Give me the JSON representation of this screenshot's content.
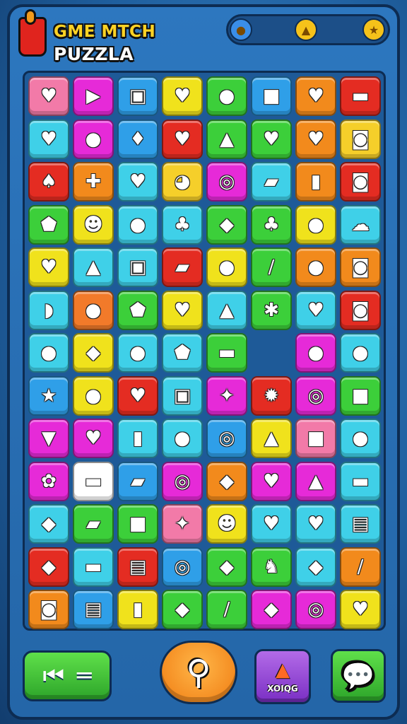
{
  "header": {
    "title_line1": "GME MTCH",
    "title_line2": "PUZZLA",
    "status": [
      {
        "icon": "globe-icon",
        "glyph": "●",
        "color": "#3a8ee8"
      },
      {
        "icon": "bell-icon",
        "glyph": "▲",
        "color": "#f5c21a"
      },
      {
        "icon": "star-icon",
        "glyph": "★",
        "color": "#f5c21a"
      }
    ]
  },
  "board": {
    "rows": 13,
    "cols": 8,
    "tiles": [
      [
        {
          "icon": "heart-icon",
          "glyph": "♥",
          "color": "#f27aa8"
        },
        {
          "icon": "triangle-icon",
          "glyph": "▶",
          "color": "#e62ad8"
        },
        {
          "icon": "scroll-icon",
          "glyph": "▣",
          "color": "#2f9fe8"
        },
        {
          "icon": "heart-icon",
          "glyph": "♥",
          "color": "#f0e21c"
        },
        {
          "icon": "orb-icon",
          "glyph": "●",
          "color": "#3ccf3a"
        },
        {
          "icon": "robot-icon",
          "glyph": "■",
          "color": "#2f9fe8"
        },
        {
          "icon": "heart-icon",
          "glyph": "♥",
          "color": "#f28a1c"
        },
        {
          "icon": "pot-icon",
          "glyph": "▬",
          "color": "#e42c22"
        }
      ],
      [
        {
          "icon": "heart-icon",
          "glyph": "♥",
          "color": "#3fd0e8"
        },
        {
          "icon": "blob-icon",
          "glyph": "●",
          "color": "#e62ad8"
        },
        {
          "icon": "strawberry-icon",
          "glyph": "♦",
          "color": "#2f9fe8"
        },
        {
          "icon": "shield-icon",
          "glyph": "♥",
          "color": "#e42c22"
        },
        {
          "icon": "triangle-icon",
          "glyph": "▲",
          "color": "#3ccf3a"
        },
        {
          "icon": "heart-icon",
          "glyph": "♥",
          "color": "#3ccf3a"
        },
        {
          "icon": "heart-icon",
          "glyph": "♥",
          "color": "#f28a1c"
        },
        {
          "icon": "safe-icon",
          "glyph": "◙",
          "color": "#f5cf2a"
        }
      ],
      [
        {
          "icon": "mushroom-icon",
          "glyph": "♠",
          "color": "#e42c22"
        },
        {
          "icon": "cross-icon",
          "glyph": "✚",
          "color": "#f28a1c"
        },
        {
          "icon": "heart-icon",
          "glyph": "♥",
          "color": "#3fd0e8"
        },
        {
          "icon": "bear-icon",
          "glyph": "◕",
          "color": "#f5cf2a"
        },
        {
          "icon": "spiral-icon",
          "glyph": "◎",
          "color": "#e62ad8"
        },
        {
          "icon": "bandage-icon",
          "glyph": "▰",
          "color": "#3fd0e8"
        },
        {
          "icon": "battery-icon",
          "glyph": "▮",
          "color": "#f28a1c"
        },
        {
          "icon": "safe-icon",
          "glyph": "◙",
          "color": "#e42c22"
        }
      ],
      [
        {
          "icon": "gem-icon",
          "glyph": "⬟",
          "color": "#3ccf3a"
        },
        {
          "icon": "smile-icon",
          "glyph": "☻",
          "color": "#f0e21c"
        },
        {
          "icon": "apple-icon",
          "glyph": "●",
          "color": "#3fd0e8"
        },
        {
          "icon": "leaf-icon",
          "glyph": "♣",
          "color": "#3fd0e8"
        },
        {
          "icon": "diamond-icon",
          "glyph": "◆",
          "color": "#3ccf3a"
        },
        {
          "icon": "bush-icon",
          "glyph": "♣",
          "color": "#3ccf3a"
        },
        {
          "icon": "blob-icon",
          "glyph": "●",
          "color": "#f0e21c"
        },
        {
          "icon": "cloud-icon",
          "glyph": "☁",
          "color": "#3fd0e8"
        }
      ],
      [
        {
          "icon": "heart-icon",
          "glyph": "♥",
          "color": "#f0e21c"
        },
        {
          "icon": "arrow-up-icon",
          "glyph": "▲",
          "color": "#3fd0e8"
        },
        {
          "icon": "camera-icon",
          "glyph": "▣",
          "color": "#3fd0e8"
        },
        {
          "icon": "crayon-icon",
          "glyph": "▰",
          "color": "#e42c22"
        },
        {
          "icon": "apple-icon",
          "glyph": "●",
          "color": "#f0e21c"
        },
        {
          "icon": "wand-icon",
          "glyph": "/",
          "color": "#3ccf3a"
        },
        {
          "icon": "pepper-icon",
          "glyph": "●",
          "color": "#f28a1c"
        },
        {
          "icon": "safe-icon",
          "glyph": "◙",
          "color": "#f28a1c"
        }
      ],
      [
        {
          "icon": "banana-icon",
          "glyph": "◗",
          "color": "#3fd0e8"
        },
        {
          "icon": "cookie-icon",
          "glyph": "●",
          "color": "#f27a2a"
        },
        {
          "icon": "shield-icon",
          "glyph": "⬟",
          "color": "#3ccf3a"
        },
        {
          "icon": "heart-icon",
          "glyph": "♥",
          "color": "#f0e21c"
        },
        {
          "icon": "triangle-icon",
          "glyph": "▲",
          "color": "#3fd0e8"
        },
        {
          "icon": "crab-icon",
          "glyph": "✱",
          "color": "#3ccf3a"
        },
        {
          "icon": "heart-icon",
          "glyph": "♥",
          "color": "#3fd0e8"
        },
        {
          "icon": "safe-icon",
          "glyph": "◙",
          "color": "#e42c22"
        }
      ],
      [
        {
          "icon": "circle-icon",
          "glyph": "●",
          "color": "#3fd0e8"
        },
        {
          "icon": "diamond-icon",
          "glyph": "◆",
          "color": "#f0e21c"
        },
        {
          "icon": "orb-icon",
          "glyph": "●",
          "color": "#3fd0e8"
        },
        {
          "icon": "gem-icon",
          "glyph": "⬟",
          "color": "#3fd0e8"
        },
        {
          "icon": "bowl-icon",
          "glyph": "▬",
          "color": "#3ccf3a"
        },
        {
          "icon": "empty-slot",
          "glyph": "",
          "color": "#1e5a98"
        },
        {
          "icon": "apple-icon",
          "glyph": "●",
          "color": "#e62ad8"
        },
        {
          "icon": "pear-icon",
          "glyph": "●",
          "color": "#3fd0e8"
        }
      ],
      [
        {
          "icon": "star-icon",
          "glyph": "★",
          "color": "#2f9fe8"
        },
        {
          "icon": "key-icon",
          "glyph": "●",
          "color": "#f0e21c"
        },
        {
          "icon": "shield-icon",
          "glyph": "♥",
          "color": "#e42c22"
        },
        {
          "icon": "camera-icon",
          "glyph": "▣",
          "color": "#3fd0e8"
        },
        {
          "icon": "candy-icon",
          "glyph": "✦",
          "color": "#e62ad8"
        },
        {
          "icon": "sun-icon",
          "glyph": "✹",
          "color": "#e42c22"
        },
        {
          "icon": "snail-icon",
          "glyph": "◎",
          "color": "#e62ad8"
        },
        {
          "icon": "robot-icon",
          "glyph": "■",
          "color": "#3ccf3a"
        }
      ],
      [
        {
          "icon": "triangle-icon",
          "glyph": "▼",
          "color": "#e62ad8"
        },
        {
          "icon": "heart-icon",
          "glyph": "♥",
          "color": "#e62ad8"
        },
        {
          "icon": "jar-icon",
          "glyph": "▮",
          "color": "#3fd0e8"
        },
        {
          "icon": "key-icon",
          "glyph": "●",
          "color": "#3fd0e8"
        },
        {
          "icon": "ring-icon",
          "glyph": "◎",
          "color": "#2f9fe8"
        },
        {
          "icon": "triangle-icon",
          "glyph": "▲",
          "color": "#f0e21c"
        },
        {
          "icon": "robot-icon",
          "glyph": "■",
          "color": "#f27aa8"
        },
        {
          "icon": "lime-icon",
          "glyph": "●",
          "color": "#3fd0e8"
        }
      ],
      [
        {
          "icon": "pretzel-icon",
          "glyph": "✿",
          "color": "#e62ad8"
        },
        {
          "icon": "soap-icon",
          "glyph": "▬",
          "color": "#ffffff"
        },
        {
          "icon": "capsule-icon",
          "glyph": "▰",
          "color": "#2f9fe8"
        },
        {
          "icon": "ring-icon",
          "glyph": "◎",
          "color": "#e62ad8"
        },
        {
          "icon": "diamond-icon",
          "glyph": "◆",
          "color": "#f28a1c"
        },
        {
          "icon": "heart-icon",
          "glyph": "♥",
          "color": "#e62ad8"
        },
        {
          "icon": "bottle-icon",
          "glyph": "▲",
          "color": "#e62ad8"
        },
        {
          "icon": "pot-icon",
          "glyph": "▬",
          "color": "#3fd0e8"
        }
      ],
      [
        {
          "icon": "lemon-icon",
          "glyph": "◆",
          "color": "#3fd0e8"
        },
        {
          "icon": "eraser-icon",
          "glyph": "▰",
          "color": "#3ccf3a"
        },
        {
          "icon": "shirt-icon",
          "glyph": "■",
          "color": "#3ccf3a"
        },
        {
          "icon": "candy-icon",
          "glyph": "✦",
          "color": "#f27aa8"
        },
        {
          "icon": "smile-icon",
          "glyph": "☻",
          "color": "#f0e21c"
        },
        {
          "icon": "heart-icon",
          "glyph": "♥",
          "color": "#3fd0e8"
        },
        {
          "icon": "heart-icon",
          "glyph": "♥",
          "color": "#3fd0e8"
        },
        {
          "icon": "basket-icon",
          "glyph": "▤",
          "color": "#3fd0e8"
        }
      ],
      [
        {
          "icon": "egg-icon",
          "glyph": "◆",
          "color": "#e42c22"
        },
        {
          "icon": "pot-icon",
          "glyph": "▬",
          "color": "#3fd0e8"
        },
        {
          "icon": "notepad-icon",
          "glyph": "▤",
          "color": "#e42c22"
        },
        {
          "icon": "spiral-icon",
          "glyph": "◎",
          "color": "#2f9fe8"
        },
        {
          "icon": "leaf-icon",
          "glyph": "◆",
          "color": "#3ccf3a"
        },
        {
          "icon": "dog-icon",
          "glyph": "♞",
          "color": "#3ccf3a"
        },
        {
          "icon": "ticket-icon",
          "glyph": "◆",
          "color": "#3fd0e8"
        },
        {
          "icon": "wand-icon",
          "glyph": "/",
          "color": "#f28a1c"
        }
      ],
      [
        {
          "icon": "safe-icon",
          "glyph": "◙",
          "color": "#f28a1c"
        },
        {
          "icon": "notepad-icon",
          "glyph": "▤",
          "color": "#2f9fe8"
        },
        {
          "icon": "bottle-icon",
          "glyph": "▮",
          "color": "#f0e21c"
        },
        {
          "icon": "bag-icon",
          "glyph": "◆",
          "color": "#3ccf3a"
        },
        {
          "icon": "syringe-icon",
          "glyph": "/",
          "color": "#3ccf3a"
        },
        {
          "icon": "egg-icon",
          "glyph": "◆",
          "color": "#e62ad8"
        },
        {
          "icon": "magnifier-icon",
          "glyph": "◎",
          "color": "#e62ad8"
        },
        {
          "icon": "heart-icon",
          "glyph": "♥",
          "color": "#f0e21c"
        }
      ]
    ]
  },
  "controls": {
    "back": {
      "icon": "back-icon",
      "glyph": "⏮",
      "menu_glyph": "═"
    },
    "search": {
      "icon": "magnifier-icon",
      "glyph": "⚲"
    },
    "booster": {
      "icon": "monster-icon",
      "glyph": "▲",
      "label": "XOIQG"
    },
    "hint": {
      "icon": "speech-hint-icon",
      "glyph": "💬"
    }
  }
}
